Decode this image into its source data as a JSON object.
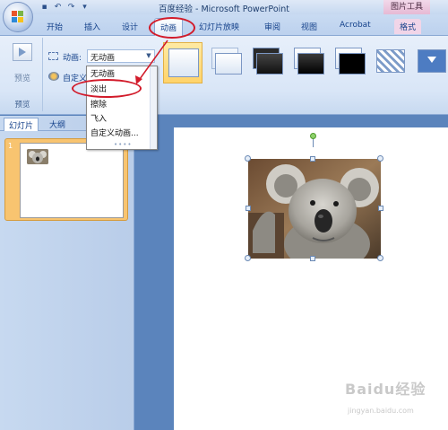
{
  "window": {
    "title": "百度经验 - Microsoft PowerPoint",
    "context_tab_group": "图片工具"
  },
  "quick_access": {
    "save_icon": "save-icon",
    "undo_icon": "undo-icon",
    "redo_icon": "redo-icon",
    "customize_icon": "customize-dropdown-icon"
  },
  "tabs": [
    {
      "label": "开始"
    },
    {
      "label": "插入"
    },
    {
      "label": "设计"
    },
    {
      "label": "动画"
    },
    {
      "label": "幻灯片放映"
    },
    {
      "label": "审阅"
    },
    {
      "label": "视图"
    },
    {
      "label": "Acrobat"
    },
    {
      "label": "格式"
    }
  ],
  "active_tab": "动画",
  "ribbon": {
    "preview_button": "预览",
    "preview_group": "预览",
    "animation_label": "动画:",
    "animation_value": "无动画",
    "custom_animation_label": "自定义"
  },
  "animation_dropdown": {
    "items": [
      "无动画",
      "淡出",
      "擦除",
      "飞入",
      "自定义动画..."
    ],
    "highlighted": "淡出"
  },
  "slides_panel": {
    "tab_slides": "幻灯片",
    "tab_outline": "大纲",
    "close": "×",
    "slide_number": "1"
  },
  "watermark": {
    "brand": "Baidu经验",
    "url": "jingyan.baidu.com"
  },
  "colors": {
    "annotation_red": "#d21b2a",
    "selected_thumb": "#f8c470",
    "workspace": "#5b84bc"
  }
}
